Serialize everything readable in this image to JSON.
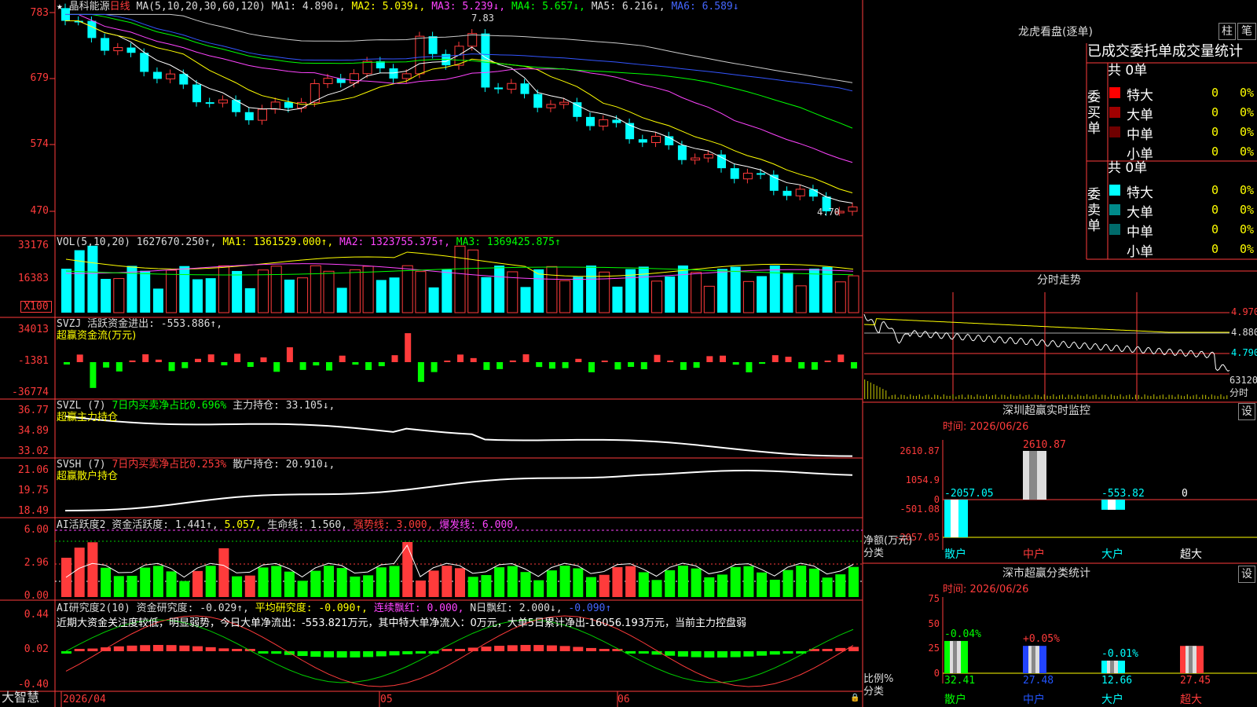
{
  "stock": {
    "title_star": "★",
    "name": "晶科能源",
    "period": "日线"
  },
  "ma_header": {
    "def": "MA(5,10,20,30,60,120)",
    "ma1": "MA1: 4.890↓,",
    "ma2": "MA2: 5.039↓,",
    "ma3": "MA3: 5.239↓,",
    "ma4": "MA4: 5.657↓,",
    "ma5": "MA5: 6.216↓,",
    "ma6": "MA6: 6.589↓"
  },
  "price_axis": [
    "783",
    "679",
    "574",
    "470"
  ],
  "price_high_label": "7.83",
  "price_low_label": "4.70",
  "vol_header": {
    "def": "VOL(5,10,20)",
    "value": "1627670.250↑,",
    "ma1": "MA1: 1361529.000↑,",
    "ma2": "MA2: 1323755.375↑,",
    "ma3": "MA3: 1369425.875↑"
  },
  "vol_axis": [
    "33176",
    "16383",
    "X100"
  ],
  "svzj": {
    "header1": "SVZJ  活跃资金进出: -553.886↑,",
    "header2": "超赢资金流(万元)",
    "axis": [
      "34013",
      "-1381",
      "-36774"
    ]
  },
  "svzl": {
    "def": "SVZL (7)",
    "metric": "7日内买卖净占比0.696%",
    "value": "主力持仓: 33.105↓,",
    "title": "超赢主力持仓",
    "axis": [
      "36.77",
      "34.89",
      "33.02"
    ]
  },
  "svsh": {
    "def": "SVSH (7)",
    "metric": "7日内买卖净占比0.253%",
    "value": "散户持仓: 20.910↓,",
    "title": "超赢散户持仓",
    "axis": [
      "21.06",
      "19.75",
      "18.49"
    ]
  },
  "ai_active": {
    "header": "AI活跃度2 资金活跃度: 1.441↑,",
    "v2": "5.057,",
    "life": "生命线: 1.560,",
    "strong": "强势线: 3.000,",
    "burst": "爆发线: 6.000,",
    "axis": [
      "6.00",
      "2.96",
      "0.00"
    ]
  },
  "ai_research": {
    "header": "AI研究度2(10) 资金研究度: -0.029↑,",
    "avg": "平均研究度: -0.090↑,",
    "red": "连续飘红: 0.000,",
    "nred": "N日飘红: 2.000↓,",
    "v5": "-0.090↑",
    "comment": "近期大资金关注度较低，明显弱势，今日大单净流出：-553.821万元，其中特大单净流入：0万元，大单5日累计净出-16056.193万元，当前主力控盘弱",
    "axis": [
      "0.44",
      "0.02",
      "-0.40"
    ]
  },
  "date_axis": [
    "2026/04",
    "05",
    "06"
  ],
  "brand": "大智慧",
  "dragon": {
    "title": "龙虎看盘(逐单)",
    "btn1": "柱",
    "btn2": "笔",
    "subtitle": "已成交委托单成交量统计",
    "buy": {
      "label": "委买单",
      "total": "共 0单",
      "rows": [
        {
          "name": "特大",
          "count": "0",
          "pct": "0%",
          "color": "#ff0000"
        },
        {
          "name": "大单",
          "count": "0",
          "pct": "0%",
          "color": "#a00000"
        },
        {
          "name": "中单",
          "count": "0",
          "pct": "0%",
          "color": "#700000"
        },
        {
          "name": "小单",
          "count": "0",
          "pct": "0%",
          "color": ""
        }
      ]
    },
    "sell": {
      "label": "委卖单",
      "total": "共 0单",
      "rows": [
        {
          "name": "特大",
          "count": "0",
          "pct": "0%",
          "color": "#00ffff"
        },
        {
          "name": "大单",
          "count": "0",
          "pct": "0%",
          "color": "#008b8b"
        },
        {
          "name": "中单",
          "count": "0",
          "pct": "0%",
          "color": "#006a6a"
        },
        {
          "name": "小单",
          "count": "0",
          "pct": "0%",
          "color": ""
        }
      ]
    }
  },
  "intraday": {
    "title": "分时走势",
    "axis": [
      "4.970",
      "4.880",
      "4.790",
      "63120"
    ],
    "unit": "分时"
  },
  "monitor": {
    "title": "深圳超赢实时监控",
    "btn": "设",
    "time": "时间: 2026/06/26",
    "axis": [
      "2610.87",
      "1054.9",
      "0",
      "-501.08",
      "-2057.05"
    ],
    "ylabel": "净额(万元)",
    "xlabel": "分类",
    "categories": [
      "散户",
      "中户",
      "大户",
      "超大"
    ],
    "values": [
      -2057.05,
      2610.87,
      -553.82,
      0
    ],
    "value_labels": [
      "-2057.05",
      "2610.87",
      "-553.82",
      "0"
    ]
  },
  "classify": {
    "title": "深市超赢分类统计",
    "btn": "设",
    "time": "时间: 2026/06/26",
    "axis": [
      "75",
      "50",
      "25",
      "0"
    ],
    "ylabel": "比例%",
    "xlabel": "分类",
    "categories": [
      "散户",
      "中户",
      "大户",
      "超大"
    ],
    "values": [
      32.41,
      27.48,
      12.66,
      27.45
    ],
    "value_labels": [
      "32.41",
      "27.48",
      "12.66",
      "27.45"
    ],
    "change_labels": [
      "-0.04%",
      "+0.05%",
      "-0.01%",
      ""
    ]
  }
}
